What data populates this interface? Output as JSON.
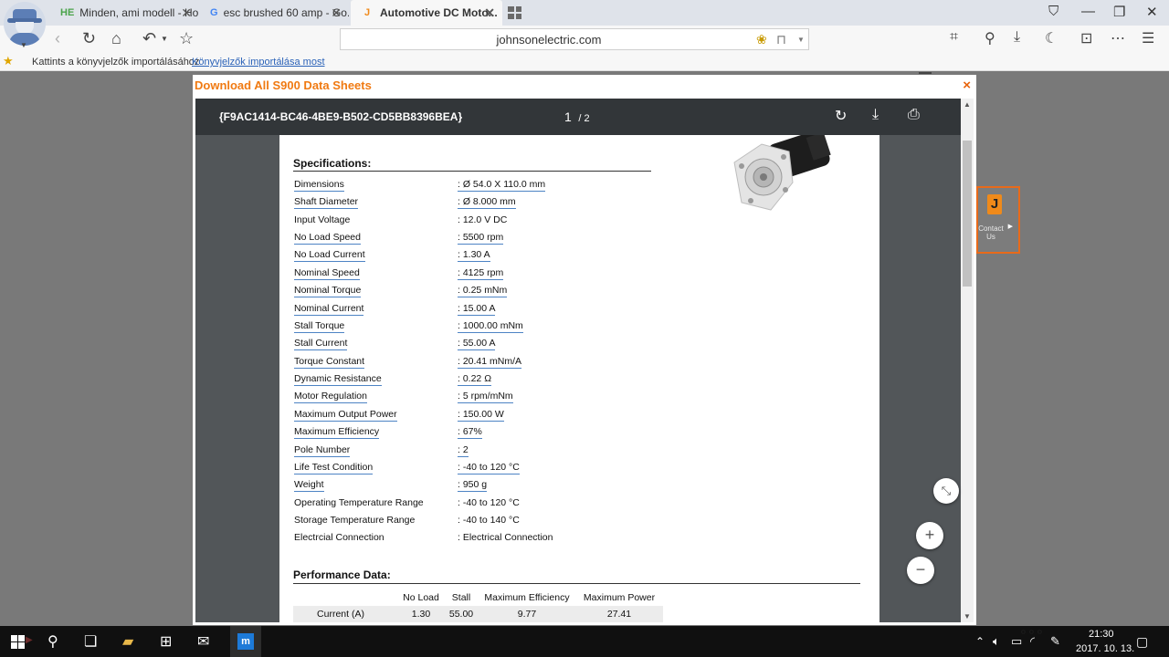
{
  "browser": {
    "tabs": [
      {
        "favicon": "HE",
        "title": "Minden, ami modell - Ho...",
        "favicon_color": "#4aa34a"
      },
      {
        "favicon": "G",
        "title": "esc brushed 60 amp - Go...",
        "favicon_color": "#4285f4"
      },
      {
        "favicon": "J",
        "title": "Automotive DC Moto...",
        "favicon_color": "#f08a1a"
      }
    ],
    "tab_close": "✕",
    "url": "johnsonelectric.com",
    "bookmarks_prompt": "Kattints a könyvjelzők importálásához",
    "bookmarks_link": "Könyvjelzők importálása most"
  },
  "page": {
    "contact_label": "Contact Us",
    "contact_logo": "J"
  },
  "modal": {
    "title": "Download All S900 Data Sheets",
    "close": "×"
  },
  "viewer": {
    "document_name": "{F9AC1414-BC46-4BE9-B502-CD5BB8396BEA}",
    "current_page": "1",
    "total_pages": "/ 2"
  },
  "specifications": {
    "heading": "Specifications:",
    "rows": [
      {
        "label": "Dimensions",
        "value": ": Ø 54.0 X 110.0 mm",
        "underlined": true
      },
      {
        "label": "Shaft Diameter",
        "value": ": Ø 8.000 mm",
        "underlined": true
      },
      {
        "label": "Input Voltage",
        "value": ": 12.0 V DC",
        "underlined": false
      },
      {
        "label": "No Load Speed",
        "value": ": 5500 rpm",
        "underlined": true
      },
      {
        "label": "No Load Current",
        "value": ": 1.30 A",
        "underlined": true
      },
      {
        "label": "Nominal Speed",
        "value": ": 4125 rpm",
        "underlined": true
      },
      {
        "label": "Nominal Torque",
        "value": ": 0.25 mNm",
        "underlined": true
      },
      {
        "label": "Nominal Current",
        "value": ": 15.00 A",
        "underlined": true
      },
      {
        "label": "Stall Torque",
        "value": ": 1000.00 mNm",
        "underlined": true
      },
      {
        "label": "Stall Current",
        "value": ": 55.00 A",
        "underlined": true
      },
      {
        "label": "Torque Constant",
        "value": ": 20.41 mNm/A",
        "underlined": true
      },
      {
        "label": "Dynamic Resistance",
        "value": ": 0.22 Ω",
        "underlined": true
      },
      {
        "label": "Motor Regulation",
        "value": ": 5 rpm/mNm",
        "underlined": true
      },
      {
        "label": "Maximum Output Power",
        "value": ": 150.00 W",
        "underlined": true
      },
      {
        "label": "Maximum Efficiency",
        "value": ": 67%",
        "underlined": true
      },
      {
        "label": "Pole Number",
        "value": ": 2",
        "underlined": true
      },
      {
        "label": "Life Test Condition",
        "value": ": -40 to 120 °C",
        "underlined": true
      },
      {
        "label": "Weight",
        "value": ": 950 g",
        "underlined": true
      },
      {
        "label": "Operating Temperature Range",
        "value": ": -40 to 120 °C",
        "underlined": false
      },
      {
        "label": "Storage Temperature Range",
        "value": ": -40 to 140 °C",
        "underlined": false
      },
      {
        "label": "Electrcial Connection",
        "value": ": Electrical Connection",
        "underlined": false
      }
    ]
  },
  "performance": {
    "heading": "Performance Data:",
    "columns": [
      "",
      "No Load",
      "Stall",
      "Maximum Efficiency",
      "Maximum Power"
    ],
    "rows": [
      {
        "cells": [
          "Current (A)",
          "1.30",
          "55.00",
          "9.77",
          "27.41"
        ]
      }
    ]
  },
  "taskbar": {
    "time": "21:30",
    "date": "2017. 10. 13.",
    "active_app_glyph": "m"
  },
  "colors": {
    "modal_title": "#f07a12",
    "link_underline": "#4d83c4",
    "viewer_toolbar": "#323639"
  }
}
